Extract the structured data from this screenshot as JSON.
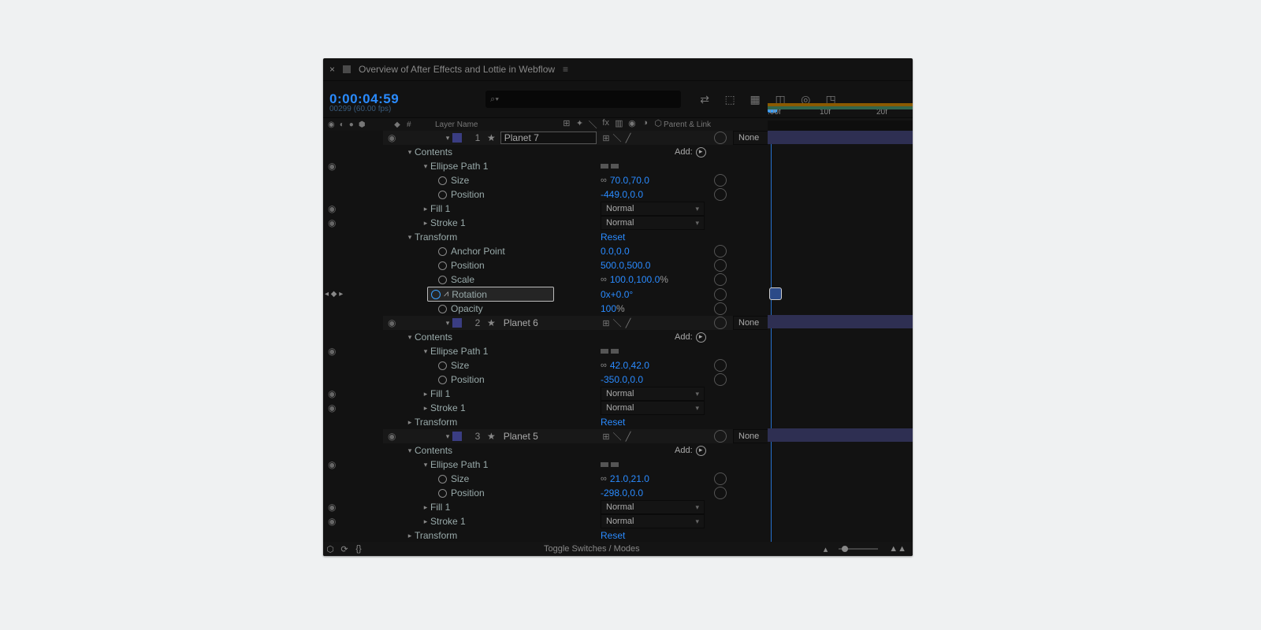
{
  "tab": {
    "title": "Overview of After Effects and Lottie in Webflow"
  },
  "timecode": "0:00:04:59",
  "subframe": "00299 (60.00 fps)",
  "ruler": {
    "t0": ":00f",
    "t1": "10f",
    "t2": "20f"
  },
  "columns": {
    "layerName": "Layer Name",
    "parentLink": "Parent & Link",
    "num": "#"
  },
  "add_label": "Add:",
  "reset": "Reset",
  "normal": "Normal",
  "none": "None",
  "footer": {
    "toggle": "Toggle Switches / Modes"
  },
  "layers": [
    {
      "num": "1",
      "name": "Planet 7",
      "boxed": true,
      "contents": {
        "label": "Contents",
        "ellipse": {
          "label": "Ellipse Path 1",
          "size_label": "Size",
          "size": "70.0,70.0",
          "pos_label": "Position",
          "pos": "-449.0,0.0"
        },
        "fill": "Fill 1",
        "stroke": "Stroke 1"
      },
      "transform": {
        "label": "Transform",
        "anchor_label": "Anchor Point",
        "anchor": "0.0,0.0",
        "pos_label": "Position",
        "pos": "500.0,500.0",
        "scale_label": "Scale",
        "scale_a": "100.0,100.0",
        "scale_b": "%",
        "rot_label": "Rotation",
        "rot": "0x+0.0°",
        "opac_label": "Opacity",
        "opac_a": "100",
        "opac_b": "%"
      }
    },
    {
      "num": "2",
      "name": "Planet 6",
      "contents": {
        "label": "Contents",
        "ellipse": {
          "label": "Ellipse Path 1",
          "size_label": "Size",
          "size": "42.0,42.0",
          "pos_label": "Position",
          "pos": "-350.0,0.0"
        },
        "fill": "Fill 1",
        "stroke": "Stroke 1"
      },
      "transform": {
        "label": "Transform"
      }
    },
    {
      "num": "3",
      "name": "Planet 5",
      "contents": {
        "label": "Contents",
        "ellipse": {
          "label": "Ellipse Path 1",
          "size_label": "Size",
          "size": "21.0,21.0",
          "pos_label": "Position",
          "pos": "-298.0,0.0"
        },
        "fill": "Fill 1",
        "stroke": "Stroke 1"
      },
      "transform": {
        "label": "Transform"
      }
    }
  ]
}
